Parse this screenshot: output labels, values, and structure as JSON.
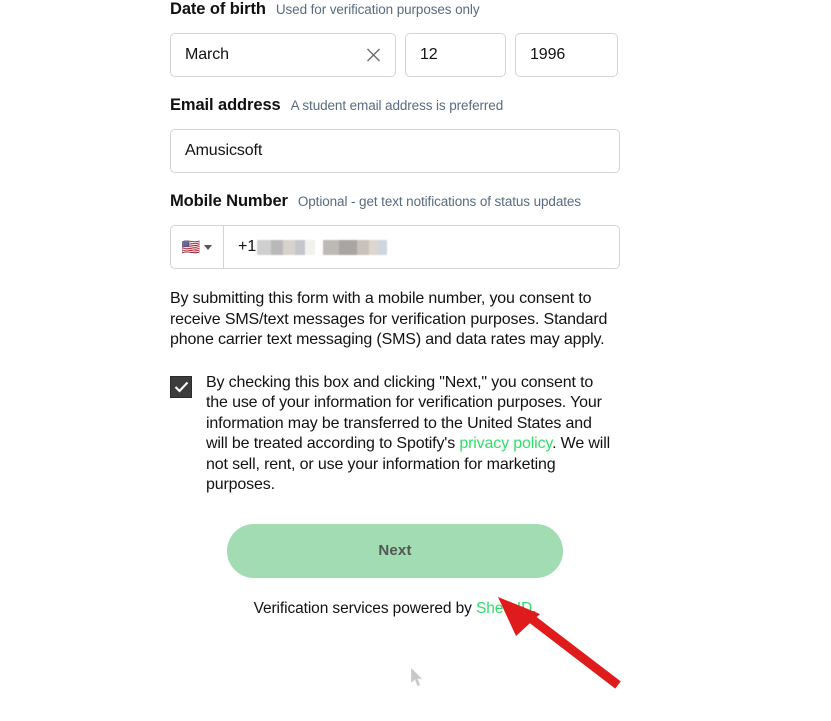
{
  "form": {
    "date_of_birth": {
      "label": "Date of birth",
      "hint": "Used for verification purposes only",
      "month_value": "March",
      "day_value": "12",
      "year_value": "1996",
      "clear_icon": "close-icon"
    },
    "email": {
      "label": "Email address",
      "hint": "A student email address is preferred",
      "value": "Amusicsoft"
    },
    "mobile": {
      "label": "Mobile Number",
      "hint": "Optional - get text notifications of status updates",
      "country_flag": "🇺🇸",
      "country_code": "+1",
      "number_value": "",
      "number_redacted": true
    },
    "sms_note": "By submitting this form with a mobile number, you consent to receive SMS/text messages for verification purposes. Standard phone carrier text messaging (SMS) and data rates may apply.",
    "consent": {
      "checked": true,
      "text_before_link": "By checking this box and clicking \"Next,\" you consent to the use of your information for verification purposes. Your information may be transferred to the United States and will be treated according to Spotify's ",
      "link_text": "privacy policy",
      "text_after_link": ". We will not sell, rent, or use your information for marketing purposes."
    },
    "submit": {
      "label": "Next"
    },
    "footer": {
      "text_before_link": "Verification services powered by ",
      "link_text": "SheerID",
      "text_after_link": "."
    }
  },
  "colors": {
    "link_green": "#2ee06a",
    "button_fill": "#a1dcb3",
    "button_text": "#555555",
    "hint_text": "#5a6b80",
    "annotation_red": "#e01b1b"
  }
}
